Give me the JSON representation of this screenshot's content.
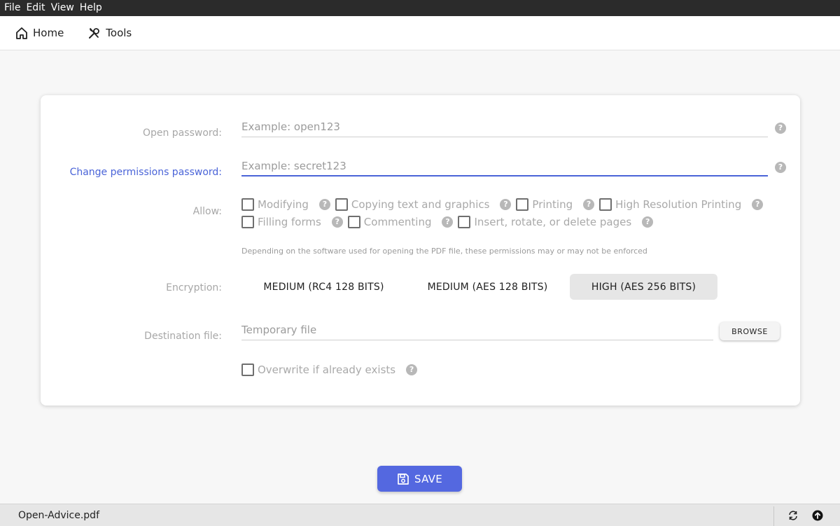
{
  "menu": [
    "File",
    "Edit",
    "View",
    "Help"
  ],
  "nav": {
    "home": "Home",
    "tools": "Tools"
  },
  "form": {
    "open_password": {
      "label": "Open password:",
      "placeholder": "Example: open123"
    },
    "permissions_password": {
      "label": "Change permissions password:",
      "placeholder": "Example: secret123"
    },
    "allow": {
      "label": "Allow:",
      "row1": [
        "Modifying",
        "Copying text and graphics",
        "Printing",
        "High Resolution Printing"
      ],
      "row2": [
        "Filling forms",
        "Commenting",
        "Insert, rotate, or delete pages"
      ],
      "note": "Depending on the software used for opening the PDF file, these permissions may or may not be enforced"
    },
    "encryption": {
      "label": "Encryption:",
      "options": [
        "MEDIUM (RC4 128 BITS)",
        "MEDIUM (AES 128 BITS)",
        "HIGH (AES 256 BITS)"
      ],
      "selected": "HIGH (AES 256 BITS)"
    },
    "destination": {
      "label": "Destination file:",
      "placeholder": "Temporary file",
      "browse": "BROWSE"
    },
    "overwrite": "Overwrite if already exists",
    "help_glyph": "?"
  },
  "save": "SAVE",
  "status": {
    "filename": "Open-Advice.pdf"
  },
  "colors": {
    "accent": "#4a64d8",
    "save_button": "#5468e0",
    "menubar": "#2b2b2b"
  },
  "icons": [
    "home-icon",
    "tools-icon",
    "help-icon",
    "floppy-disk-icon",
    "sync-icon",
    "upload-icon"
  ]
}
